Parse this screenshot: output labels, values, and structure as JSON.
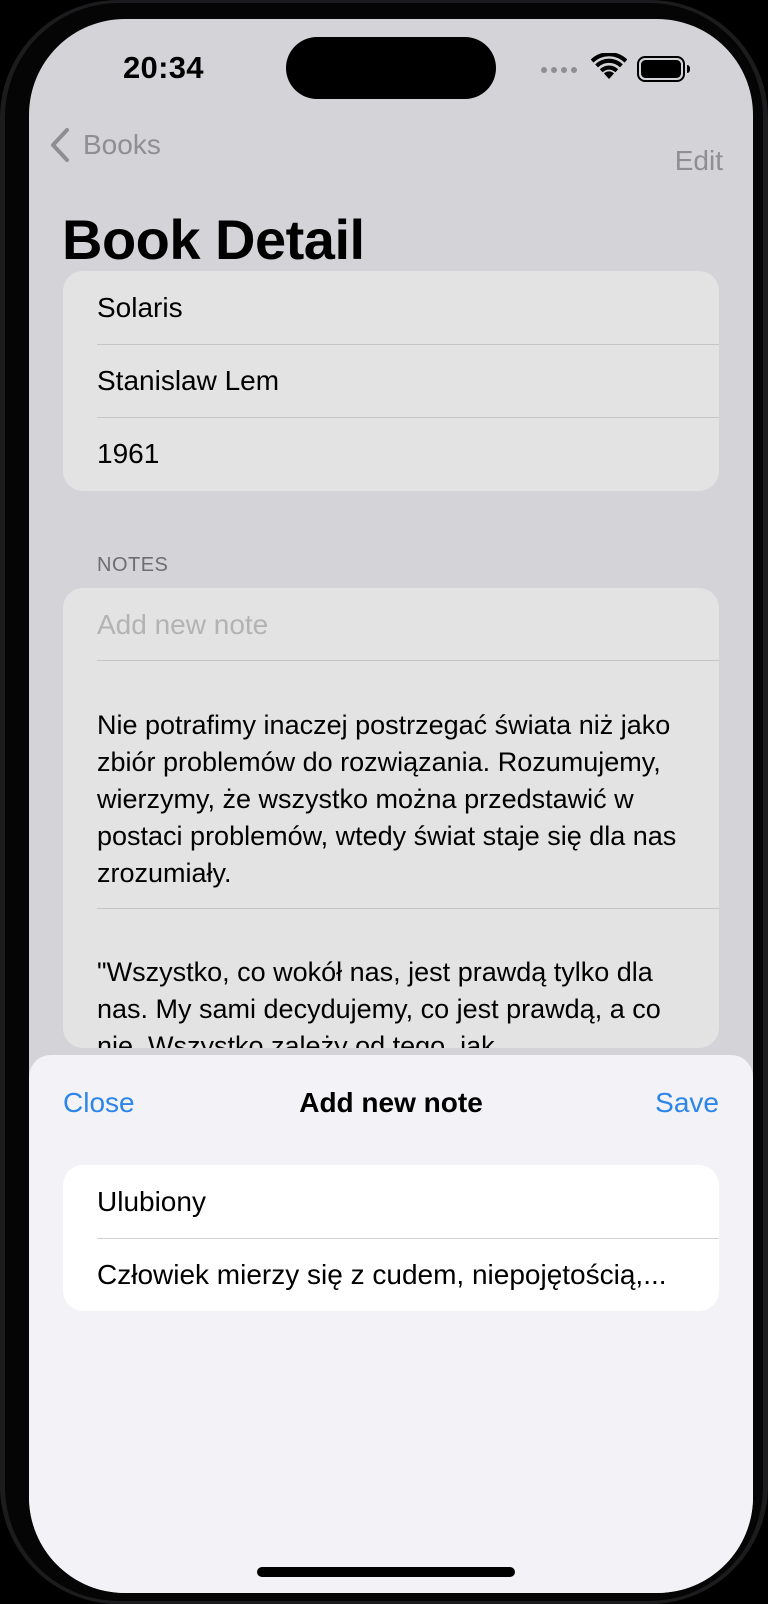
{
  "status_bar": {
    "time": "20:34"
  },
  "nav": {
    "back_label": "Books",
    "edit_label": "Edit",
    "title": "Book Detail"
  },
  "book": {
    "title": "Solaris",
    "author": "Stanislaw Lem",
    "year": "1961"
  },
  "notes": {
    "header": "NOTES",
    "placeholder": "Add new note",
    "items": [
      "Nie potrafimy inaczej postrzegać świata niż jako zbiór problemów do rozwiązania. Rozumujemy, wierzymy, że wszystko można przedstawić w postaci problemów, wtedy świat staje się dla nas zrozumiały.",
      "\"Wszystko, co wokół nas, jest prawdą tylko dla nas. My sami decydujemy, co jest prawdą, a co nie. Wszystko zależy od tego, jak"
    ]
  },
  "sheet": {
    "close_label": "Close",
    "title": "Add new note",
    "save_label": "Save",
    "note_title_value": "Ulubiony",
    "note_body_value": "Człowiek mierzy się z cudem, niepojętością,..."
  },
  "colors": {
    "accent": "#2c85e8",
    "dimmed_background": "#d4d4d8",
    "sheet_background": "#f2f2f7"
  },
  "icons": {
    "back": "chevron-left-icon",
    "wifi": "wifi-icon",
    "battery": "battery-icon",
    "cellular": "cellular-icon"
  }
}
